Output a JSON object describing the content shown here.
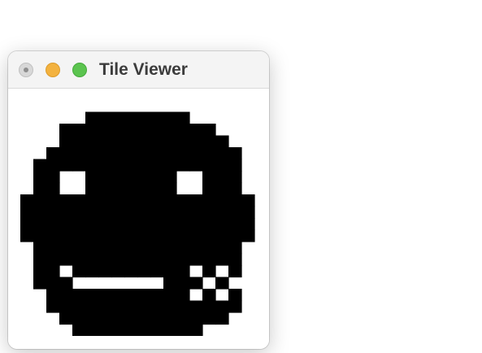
{
  "window": {
    "title": "Tile Viewer",
    "traffic_lights": [
      {
        "name": "close",
        "color": "#d8d8d8"
      },
      {
        "name": "minimize",
        "color": "#f3b23f"
      },
      {
        "name": "zoom",
        "color": "#5bc44f"
      }
    ]
  },
  "tile": {
    "foreground": "#000000",
    "background": "#ffffff",
    "grid_size": 18,
    "rows": [
      "000000000000000000",
      "000001111111100000",
      "000111111111111000",
      "000111111111111100",
      "001111111111111110",
      "011111111111111110",
      "011001111111001110",
      "011001111111001110",
      "111111111111111111",
      "111111111111111111",
      "111111111111111111",
      "111111111111111111",
      "011111111111111110",
      "011111111111111110",
      "011011111111101010",
      "011100000001110100",
      "001111111111101010",
      "001111111111111110",
      "000111111111111100",
      "000011111111110000",
      "000000000000000000"
    ]
  }
}
